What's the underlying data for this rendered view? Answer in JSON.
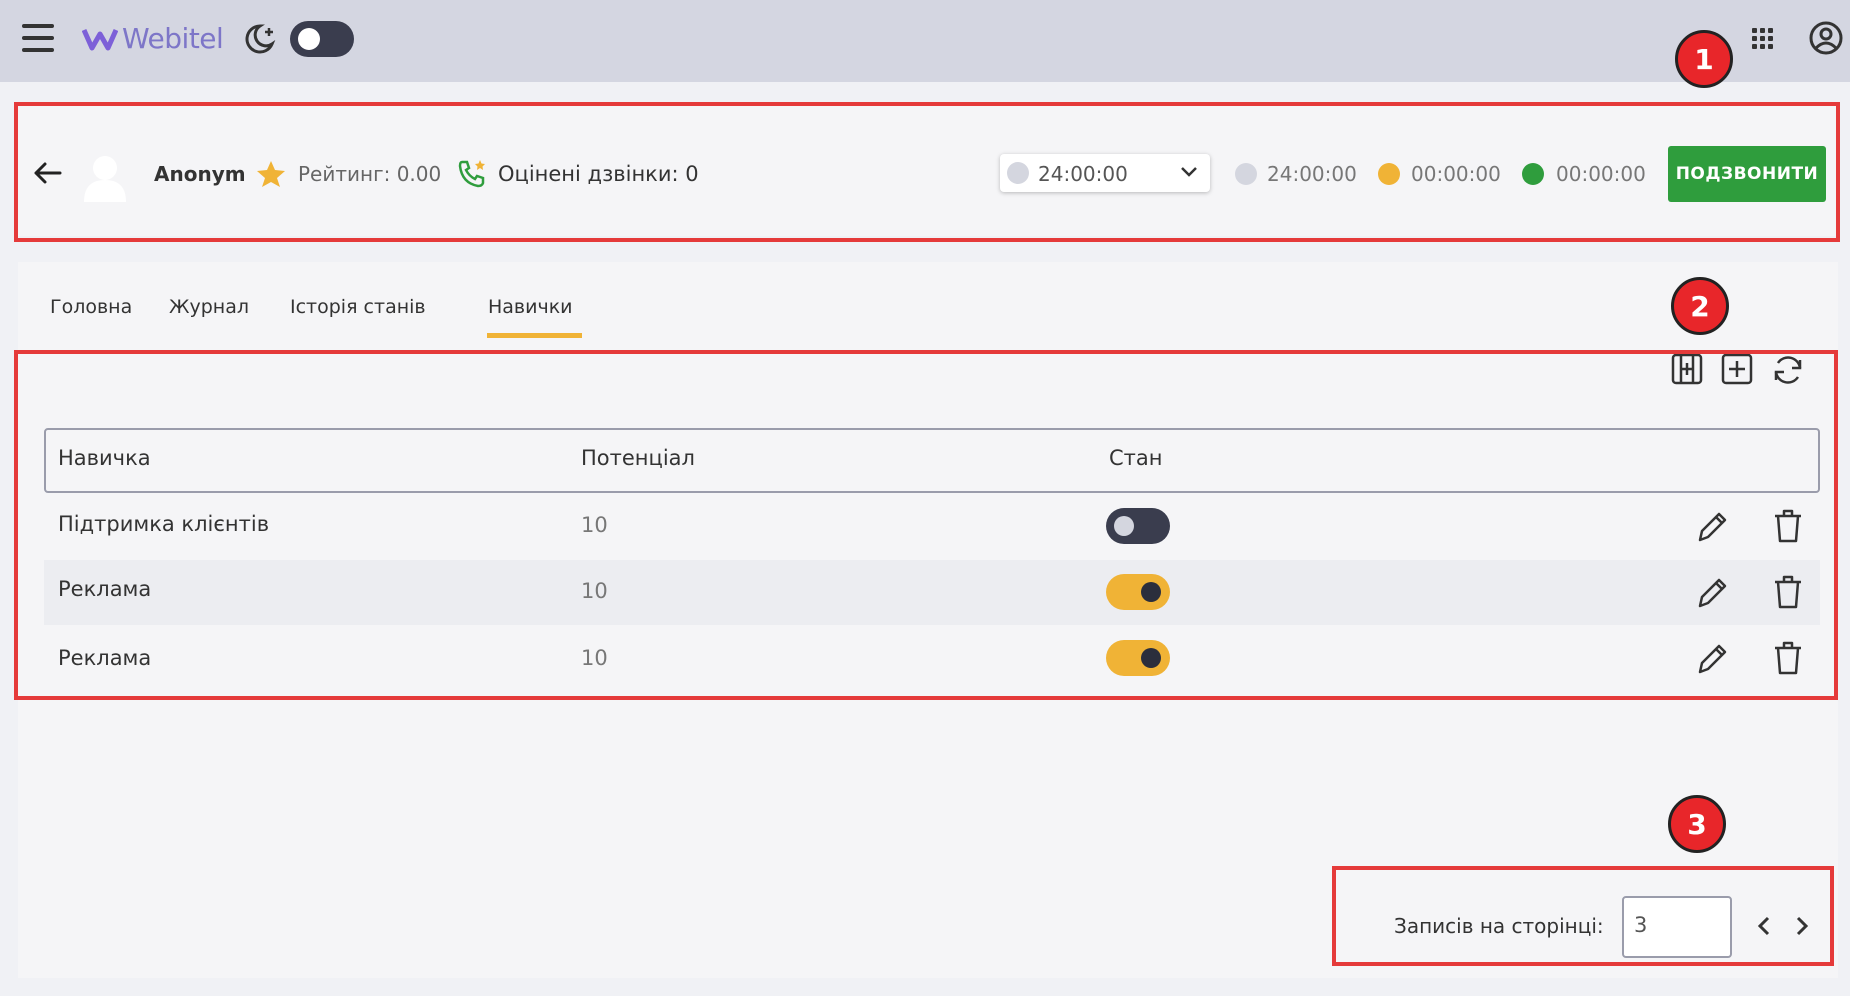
{
  "app": {
    "logo_text": "Webitel"
  },
  "agent": {
    "name": "Anonym",
    "rating_label": "Рейтинг: 0.00",
    "rated_calls_label": "Оцінені дзвінки: 0"
  },
  "status": {
    "selected_value": "24:00:00",
    "timers": [
      {
        "value": "24:00:00",
        "color": "#d4d6df"
      },
      {
        "value": "00:00:00",
        "color": "#f0b336"
      },
      {
        "value": "00:00:00",
        "color": "#2f9d3d"
      }
    ],
    "call_button_label": "ПОДЗВОНИТИ"
  },
  "tabs": [
    {
      "label": "Головна",
      "active": false
    },
    {
      "label": "Журнал",
      "active": false
    },
    {
      "label": "Історія станів",
      "active": false
    },
    {
      "label": "Навички",
      "active": true
    }
  ],
  "table": {
    "columns": [
      "Навичка",
      "Потенціал",
      "Стан"
    ],
    "rows": [
      {
        "skill": "Підтримка клієнтів",
        "potential": "10",
        "state": false
      },
      {
        "skill": "Реклама",
        "potential": "10",
        "state": true
      },
      {
        "skill": "Реклама",
        "potential": "10",
        "state": true
      }
    ]
  },
  "pagination": {
    "per_page_label": "Записів на сторінці:",
    "per_page_value": "3"
  },
  "markers": [
    "1",
    "2",
    "3"
  ],
  "colors": {
    "accent": "#f0b336",
    "call_button": "#2f9d3d",
    "annotation_red": "#e53a3a"
  },
  "icons": [
    "menu-icon",
    "webitel-logo-icon",
    "moon-icon",
    "apps-grid-icon",
    "user-account-icon",
    "back-arrow-icon",
    "avatar-icon",
    "star-icon",
    "phone-star-icon",
    "chevron-down-icon",
    "column-settings-icon",
    "add-icon",
    "refresh-icon",
    "pencil-icon",
    "trash-icon",
    "chevron-left-icon",
    "chevron-right-icon"
  ]
}
